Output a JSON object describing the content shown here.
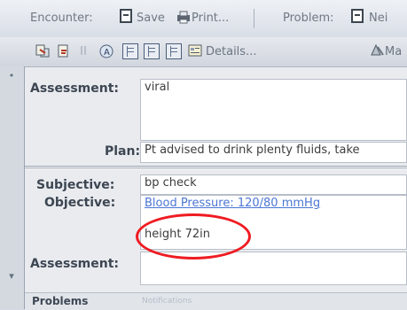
{
  "toolbar": {
    "encounter_label": "Encounter:",
    "save_label": "Save",
    "print_label": "Print...",
    "problem_label": "Problem:",
    "new_label": "Nei",
    "details_label": "Details...",
    "more_label": "Ma"
  },
  "form": {
    "assessment1_label": "Assessment:",
    "assessment1_value": "viral",
    "plan_label": "Plan:",
    "plan_value": "Pt advised to drink plenty fluids, take",
    "subjective_label": "Subjective:",
    "subjective_value": "bp check",
    "objective_label": "Objective:",
    "objective_link": "Blood Pressure: 120/80 mmHg",
    "objective_extra": "height 72in",
    "assessment2_label": "Assessment:"
  },
  "tabs": {
    "problems_label": "Problems",
    "notifications_label": "Notifications"
  },
  "colors": {
    "annotation_circle": "#ef1b22",
    "link": "#4b76d3"
  }
}
